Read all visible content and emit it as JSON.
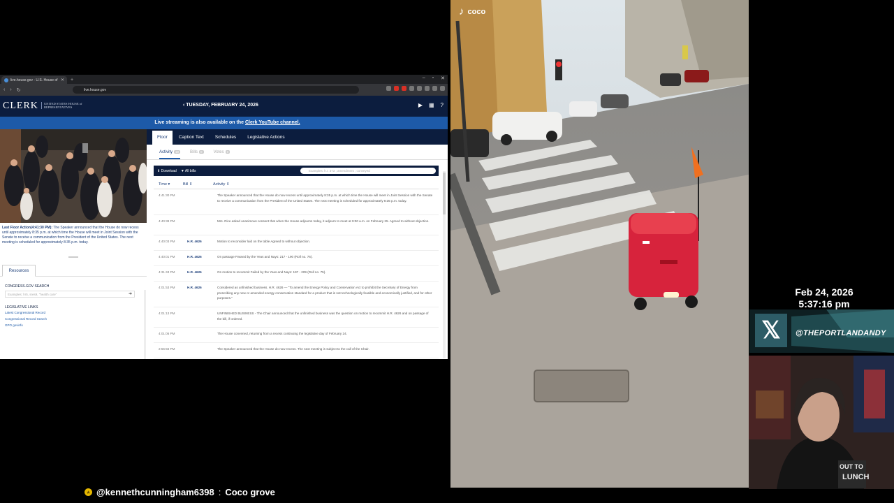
{
  "browser": {
    "tab_title": "live.house.gov - U.S. House of",
    "url": "live.house.gov"
  },
  "clerk": {
    "logo": "CLERK",
    "subtitle": "UNITED STATES HOUSE of REPRESENTATIVES",
    "date": "TUESDAY, FEBRUARY 24, 2026",
    "live_banner_text": "Live streaming is also available on the",
    "live_banner_link": "Clerk YouTube channel."
  },
  "last_floor_action": {
    "label": "Last Floor Action(4:41:30 PM):",
    "text": "The Speaker announced that the House do now recess until approximately 8:35 p.m. at which time the House will meet in Joint Session with the Senate to receive a communication from the President of the United States. The next meeting is scheduled for approximately 8:35 p.m. today."
  },
  "resources": {
    "tab": "Resources",
    "congress_search_label": "CONGRESS.GOV SEARCH",
    "congress_search_placeholder": "Examples: hr5, sres9, \"health care\"",
    "legislative_links_label": "LEGISLATIVE LINKS",
    "links": [
      "Latest Congressional Record",
      "Congressional Record Search",
      "GPO govinfo"
    ]
  },
  "tabs": [
    "Floor",
    "Caption Text",
    "Schedules",
    "Legislative Actions"
  ],
  "subtabs": [
    {
      "label": "Activity",
      "count": "19"
    },
    {
      "label": "Bills",
      "count": "0"
    },
    {
      "label": "Votes",
      "count": "0"
    }
  ],
  "activity_bar": {
    "download": "Download",
    "filter": "All bills",
    "search_placeholder": "Examples: h.r. 373 ; amendment ; conveyed"
  },
  "columns": {
    "time": "Time",
    "bill": "Bill",
    "activity": "Activity"
  },
  "rows": [
    {
      "time": "4:41:30 PM",
      "bill": "",
      "activity": "The Speaker announced that the House do now recess until approximately 8:35 p.m. at which time the House will meet in Joint Session with the Senate to receive a communication from the President of the United States. The next meeting is scheduled for approximately 8:35 p.m. today."
    },
    {
      "time": "4:40:38 PM",
      "bill": "",
      "activity": "Mrs. Rice asked unanimous consent that when the House adjourns today, it adjourn to meet at 9:00 a.m. on February 25. Agreed to without objection."
    },
    {
      "time": "4:40:03 PM",
      "bill": "H.R. 4626",
      "activity": "Motion to reconsider laid on the table Agreed to without objection."
    },
    {
      "time": "4:40:01 PM",
      "bill": "H.R. 4626",
      "activity": "On passage Passed by the Yeas and Nays: 217 - 190 (Roll no. 76)."
    },
    {
      "time": "4:31:43 PM",
      "bill": "H.R. 4626",
      "activity": "On motion to recommit Failed by the Yeas and Nays: 197 - 209 (Roll no. 75)."
    },
    {
      "time": "4:01:53 PM",
      "bill": "H.R. 4626",
      "activity": "Considered as unfinished business. H.R. 4626 — \"To amend the Energy Policy and Conservation Act to prohibit the Secretary of Energy from prescribing any new or amended energy conservation standard for a product that is not technologically feasible and economically justified, and for other purposes.\""
    },
    {
      "time": "4:01:13 PM",
      "bill": "",
      "activity": "UNFINISHED BUSINESS - The Chair announced that the unfinished business was the question on motion to recommit H.R. 4626 and on passage of the bill, if ordered."
    },
    {
      "time": "4:01:06 PM",
      "bill": "",
      "activity": "The House convened, returning from a recess continuing the legislative day of February 24."
    },
    {
      "time": "2:56:56 PM",
      "bill": "",
      "activity": "The Speaker announced that the House do now recess. The next meeting is subject to the call of the Chair."
    }
  ],
  "tiktok": {
    "username": "coco"
  },
  "overlay": {
    "date": "Feb 24, 2026",
    "time": "5:37:16 pm",
    "handle": "@THEPORTLANDANDY",
    "shirt_text": "OUT TO LUNCH"
  },
  "chat": {
    "username": "@kennethcunningham6398",
    "separator": ":",
    "message": "Coco grove"
  }
}
